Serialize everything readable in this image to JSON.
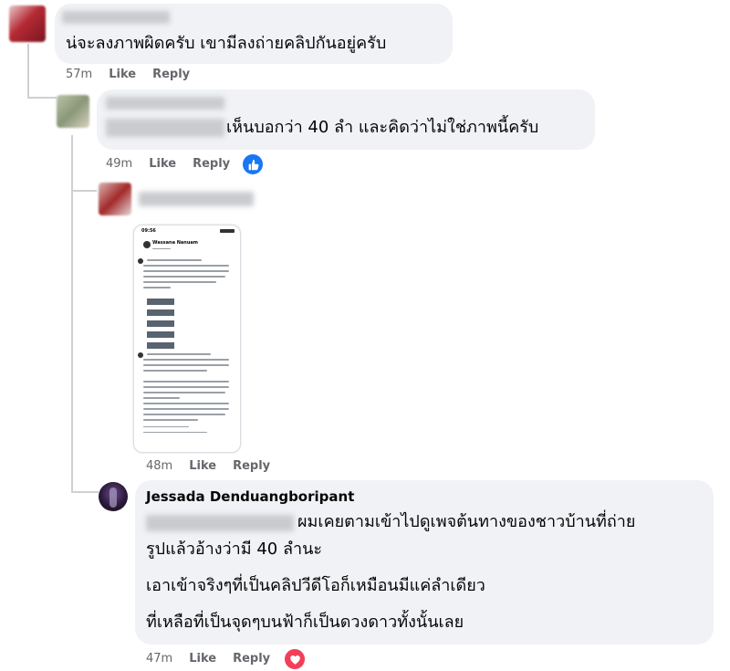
{
  "comments": [
    {
      "text": "น่จะลงภาพผิดครับ เขามีลงถ่ายคลิปกันอยู่ครับ",
      "time": "57m",
      "like": "Like",
      "reply": "Reply"
    },
    {
      "text": "เห็นบอกว่า 40 ลำ และคิดว่าไม่ใช่ภาพนี้ครับ",
      "time": "49m",
      "like": "Like",
      "reply": "Reply",
      "reaction": "like-reaction-icon"
    },
    {
      "time": "48m",
      "like": "Like",
      "reply": "Reply",
      "attachment": {
        "status_time": "09:56",
        "author": "Wassana Nanuam",
        "type": "screenshot"
      }
    },
    {
      "author": "Jessada Denduangboripant",
      "lines": [
        "ผมเคยตามเข้าไปดูเพจต้นทางของชาวบ้านที่ถ่าย",
        "รูปแล้วอ้างว่ามี 40 ลำนะ",
        "เอาเข้าจริงๆที่เป็นคลิปวีดีโอก็เหมือนมีแค่ลำเดียว",
        "ที่เหลือที่เป็นจุดๆบนฟ้าก็เป็นดวงดาวทั้งนั้นเลย"
      ],
      "time": "47m",
      "like": "Like",
      "reply": "Reply",
      "reaction": "love-reaction-icon"
    }
  ],
  "colors": {
    "bubble": "#f0f2f5",
    "meta": "#65676b",
    "like_blue": "#1877f2",
    "love_red": "#f33e58"
  }
}
